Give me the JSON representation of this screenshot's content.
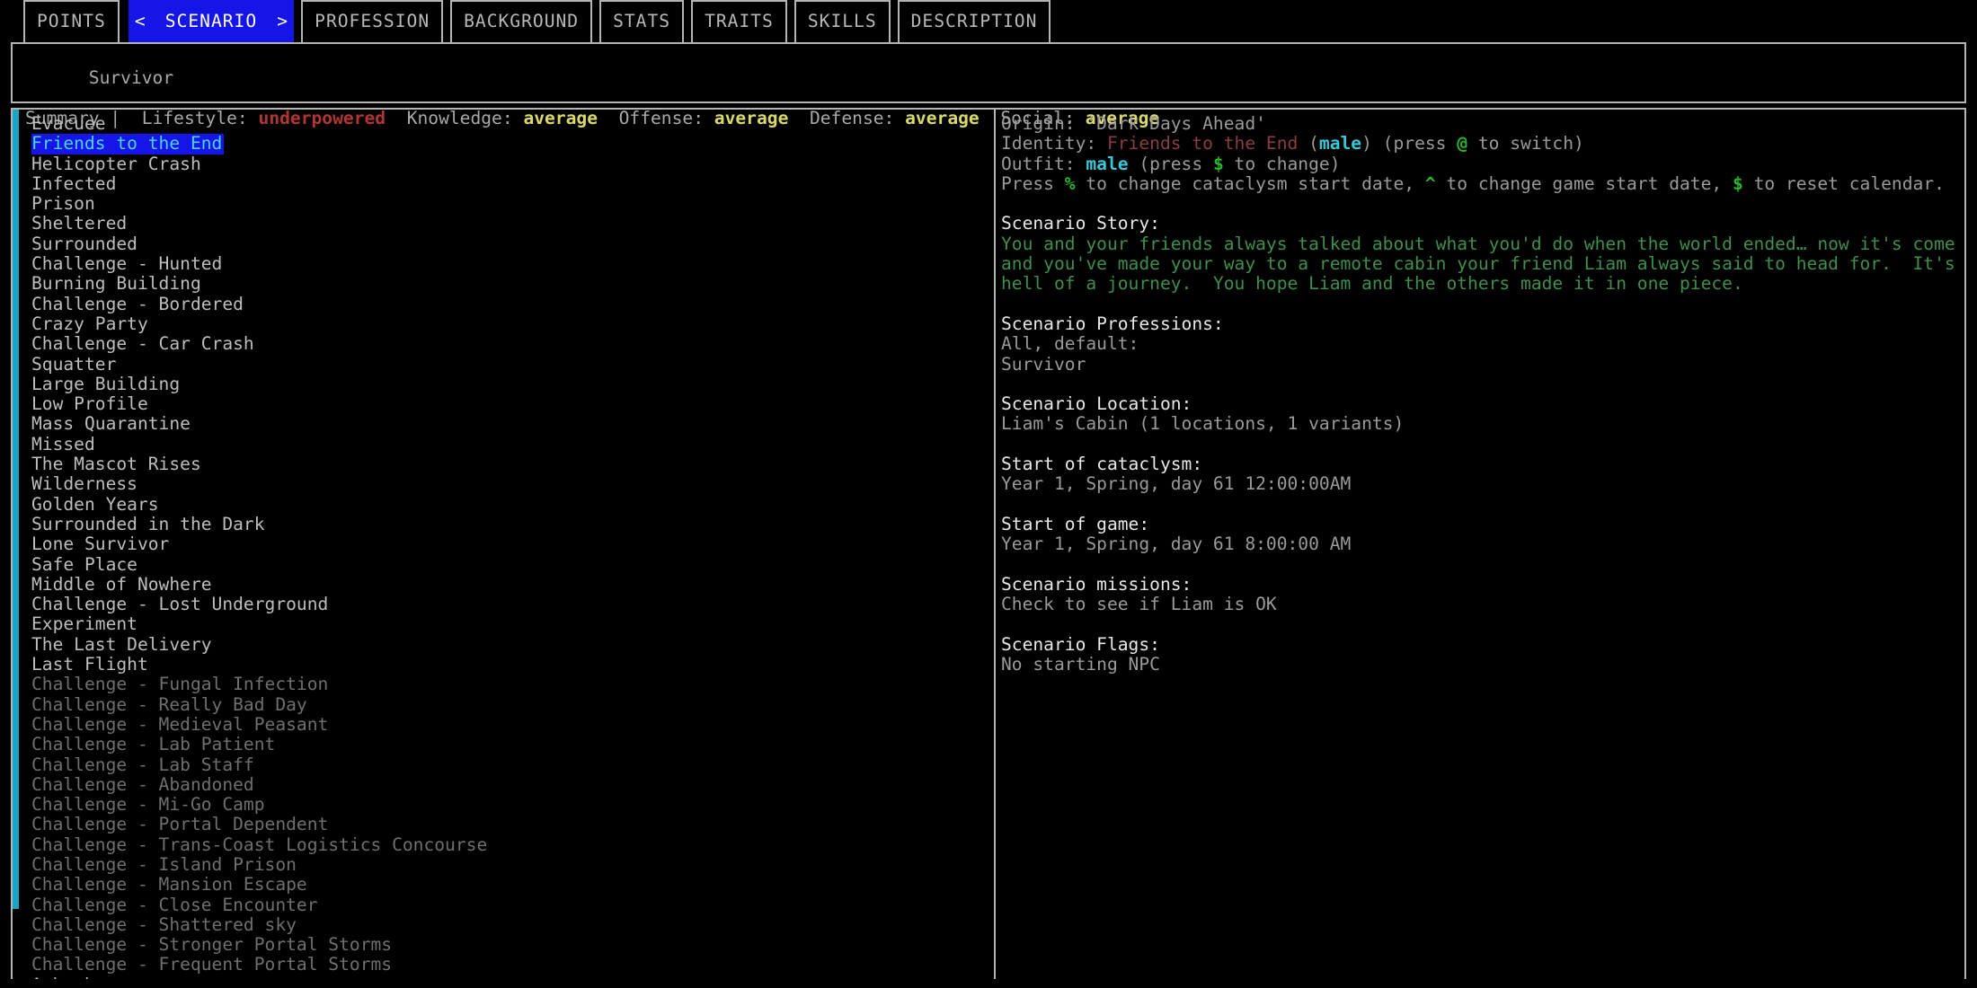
{
  "tabs": [
    {
      "label": "POINTS",
      "selected": false
    },
    {
      "label": "SCENARIO",
      "selected": true
    },
    {
      "label": "PROFESSION",
      "selected": false
    },
    {
      "label": "BACKGROUND",
      "selected": false
    },
    {
      "label": "STATS",
      "selected": false
    },
    {
      "label": "TRAITS",
      "selected": false
    },
    {
      "label": "SKILLS",
      "selected": false
    },
    {
      "label": "DESCRIPTION",
      "selected": false
    }
  ],
  "nav": {
    "prev_arrow": "<",
    "next_arrow": ">"
  },
  "summary": {
    "profession": "Survivor",
    "label": "Summary |",
    "stats": [
      {
        "name": "Lifestyle:",
        "value": "underpowered",
        "color": "#b23535"
      },
      {
        "name": "Knowledge:",
        "value": "average",
        "color": "#d9d96a"
      },
      {
        "name": "Offense:",
        "value": "average",
        "color": "#d9d96a"
      },
      {
        "name": "Defense:",
        "value": "average",
        "color": "#d9d96a"
      },
      {
        "name": "Social:",
        "value": "average",
        "color": "#d9d96a"
      }
    ]
  },
  "scenario_list": {
    "selected_index": 1,
    "items": [
      {
        "label": "Evacuee",
        "dim": false
      },
      {
        "label": "Friends to the End",
        "dim": false
      },
      {
        "label": "Helicopter Crash",
        "dim": false
      },
      {
        "label": "Infected",
        "dim": false
      },
      {
        "label": "Prison",
        "dim": false
      },
      {
        "label": "Sheltered",
        "dim": false
      },
      {
        "label": "Surrounded",
        "dim": false
      },
      {
        "label": "Challenge - Hunted",
        "dim": false
      },
      {
        "label": "Burning Building",
        "dim": false
      },
      {
        "label": "Challenge - Bordered",
        "dim": false
      },
      {
        "label": "Crazy Party",
        "dim": false
      },
      {
        "label": "Challenge - Car Crash",
        "dim": false
      },
      {
        "label": "Squatter",
        "dim": false
      },
      {
        "label": "Large Building",
        "dim": false
      },
      {
        "label": "Low Profile",
        "dim": false
      },
      {
        "label": "Mass Quarantine",
        "dim": false
      },
      {
        "label": "Missed",
        "dim": false
      },
      {
        "label": "The Mascot Rises",
        "dim": false
      },
      {
        "label": "Wilderness",
        "dim": false
      },
      {
        "label": "Golden Years",
        "dim": false
      },
      {
        "label": "Surrounded in the Dark",
        "dim": false
      },
      {
        "label": "Lone Survivor",
        "dim": false
      },
      {
        "label": "Safe Place",
        "dim": false
      },
      {
        "label": "Middle of Nowhere",
        "dim": false
      },
      {
        "label": "Challenge - Lost Underground",
        "dim": false
      },
      {
        "label": "Experiment",
        "dim": false
      },
      {
        "label": "The Last Delivery",
        "dim": false
      },
      {
        "label": "Last Flight",
        "dim": false
      },
      {
        "label": "Challenge - Fungal Infection",
        "dim": true
      },
      {
        "label": "Challenge - Really Bad Day",
        "dim": true
      },
      {
        "label": "Challenge - Medieval Peasant",
        "dim": true
      },
      {
        "label": "Challenge - Lab Patient",
        "dim": true
      },
      {
        "label": "Challenge - Lab Staff",
        "dim": true
      },
      {
        "label": "Challenge - Abandoned",
        "dim": true
      },
      {
        "label": "Challenge - Mi-Go Camp",
        "dim": true
      },
      {
        "label": "Challenge - Portal Dependent",
        "dim": true
      },
      {
        "label": "Challenge - Trans-Coast Logistics Concourse",
        "dim": true
      },
      {
        "label": "Challenge - Island Prison",
        "dim": true
      },
      {
        "label": "Challenge - Mansion Escape",
        "dim": true
      },
      {
        "label": "Challenge - Close Encounter",
        "dim": true
      },
      {
        "label": "Challenge - Shattered sky",
        "dim": true
      },
      {
        "label": "Challenge - Stronger Portal Storms",
        "dim": true
      },
      {
        "label": "Challenge - Frequent Portal Storms",
        "dim": true
      },
      {
        "label": "Ambush",
        "dim": false
      }
    ]
  },
  "details": {
    "origin_label": "Origin: ",
    "origin_value": "'Dark Days Ahead'",
    "identity_label": "Identity: ",
    "identity_value": "Friends to the End",
    "identity_gender": " (male)",
    "identity_hint_pre": " (press ",
    "identity_hint_key": "@",
    "identity_hint_post": " to switch)",
    "outfit_label": "Outfit: ",
    "outfit_value": "male",
    "outfit_hint_pre": " (press ",
    "outfit_hint_key": "$",
    "outfit_hint_post": " to change)",
    "calendar_pre": "Press ",
    "calendar_key1": "%",
    "calendar_mid1": " to change cataclysm start date, ",
    "calendar_key2": "^",
    "calendar_mid2": " to change game start date, ",
    "calendar_key3": "$",
    "calendar_post": " to reset calendar.",
    "story_heading": "Scenario Story:",
    "story_lines": [
      "You and your friends always talked about what you'd do when the world ended… now it's come true,",
      "and you've made your way to a remote cabin your friend Liam always said to head for.  It's been a",
      "hell of a journey.  You hope Liam and the others made it in one piece."
    ],
    "professions_heading": "Scenario Professions:",
    "professions_lines": [
      "All, default:",
      "Survivor"
    ],
    "location_heading": "Scenario Location:",
    "location_value": "Liam's Cabin (1 locations, 1 variants)",
    "cataclysm_heading": "Start of cataclysm:",
    "cataclysm_value": "Year 1, Spring, day 61 12:00:00AM",
    "game_start_heading": "Start of game:",
    "game_start_value": "Year 1, Spring, day 61 8:00:00 AM",
    "missions_heading": "Scenario missions:",
    "missions_value": "Check to see if Liam is OK",
    "flags_heading": "Scenario Flags:",
    "flags_value": "No starting NPC"
  }
}
